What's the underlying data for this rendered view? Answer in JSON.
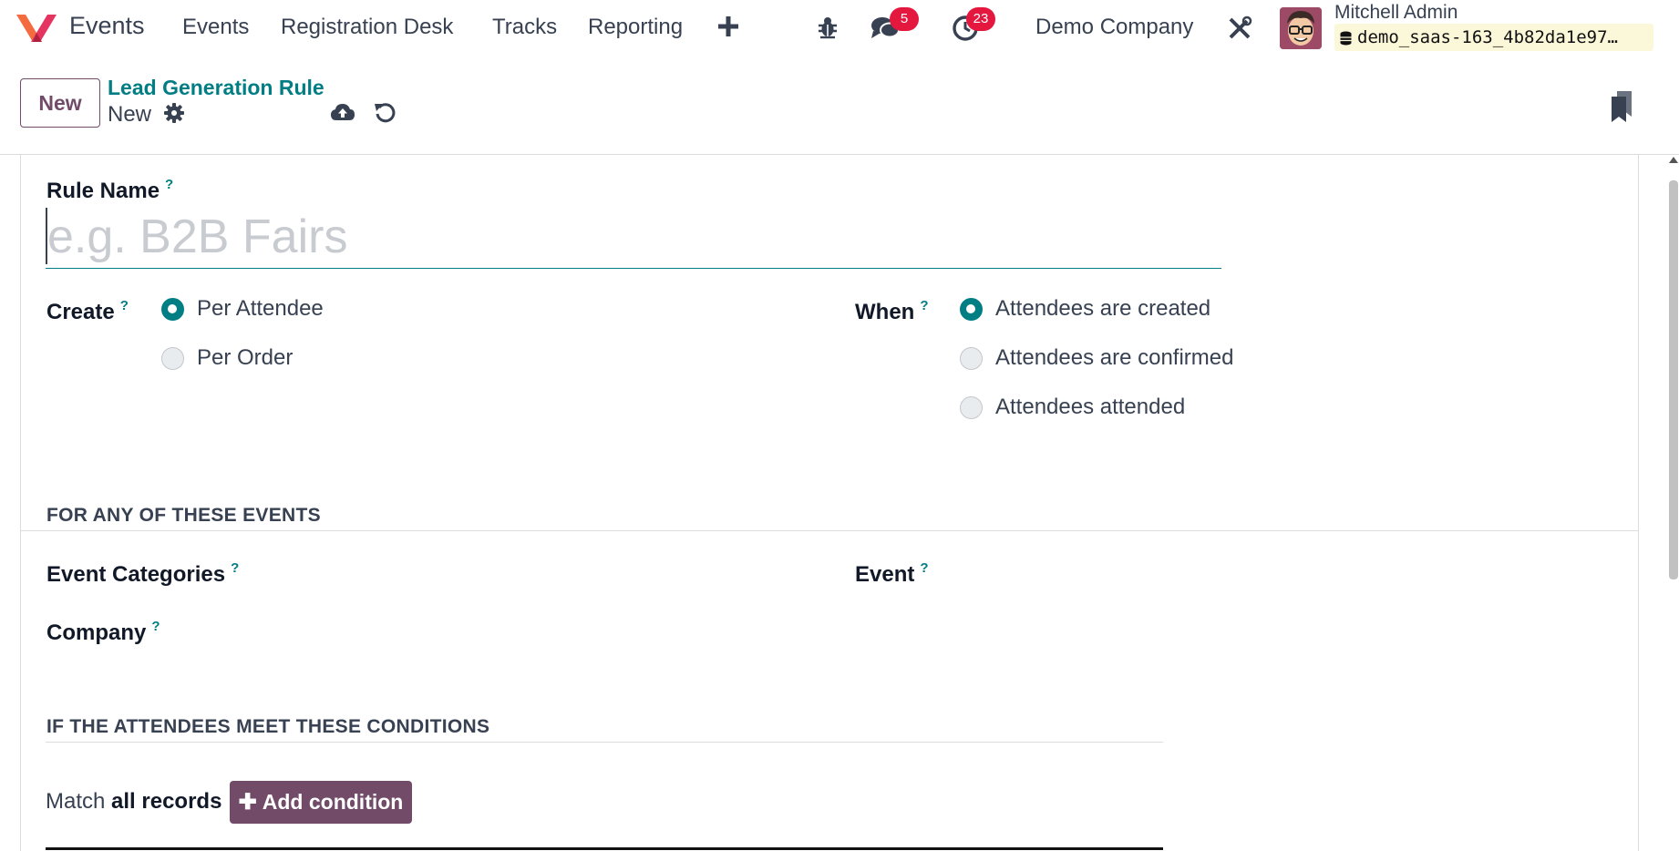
{
  "navbar": {
    "app_name": "Events",
    "menu": [
      "Events",
      "Registration Desk",
      "Tracks",
      "Reporting"
    ],
    "plus_icon": "plus-icon",
    "debug_icon": "bug-icon",
    "messages_count": "5",
    "activities_count": "23",
    "company": "Demo Company",
    "settings_icon": "tools-icon",
    "user_name": "Mitchell Admin",
    "database": "demo_saas-163_4b82da1e97…"
  },
  "control_panel": {
    "new_button": "New",
    "breadcrumb": "Lead Generation Rule",
    "record_title": "New",
    "icons": [
      "gear-icon",
      "cloud-upload-icon",
      "undo-icon",
      "bookmark-icon"
    ]
  },
  "form": {
    "rule_name_label": "Rule Name",
    "help_mark": "?",
    "rule_name_placeholder": "e.g. B2B Fairs",
    "create_label": "Create",
    "create_options": [
      "Per Attendee",
      "Per Order"
    ],
    "create_selected": "Per Attendee",
    "when_label": "When",
    "when_options": [
      "Attendees are created",
      "Attendees are confirmed",
      "Attendees attended"
    ],
    "when_selected": "Attendees are created",
    "section_events": "FOR ANY OF THESE EVENTS",
    "event_categories_label": "Event Categories",
    "event_label": "Event",
    "company_label": "Company",
    "section_conditions": "IF THE ATTENDEES MEET THESE CONDITIONS",
    "match_prefix": "Match",
    "match_strong": "all records",
    "add_condition": "Add condition"
  },
  "colors": {
    "brand": "#714b67",
    "accent": "#017e84",
    "badge": "#e4173f"
  }
}
